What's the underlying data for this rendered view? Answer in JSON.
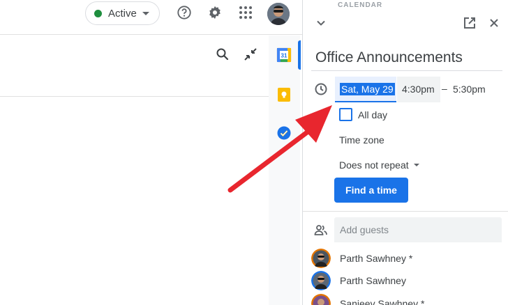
{
  "header": {
    "status_label": "Active",
    "icons": [
      "help-icon",
      "settings-icon",
      "apps-grid-icon",
      "account-avatar"
    ]
  },
  "subbar": {
    "icons": [
      "search-icon",
      "collapse-icon"
    ]
  },
  "side_panel": {
    "apps": [
      "calendar-app-icon",
      "keep-app-icon",
      "tasks-app-icon"
    ],
    "calendar_icon_number": "31"
  },
  "event_panel": {
    "section_label": "CALENDAR",
    "title": "Office Announcements",
    "date": "Sat, May 29",
    "start_time": "4:30pm",
    "separator": "–",
    "end_time": "5:30pm",
    "all_day_label": "All day",
    "all_day_checked": false,
    "time_zone_label": "Time zone",
    "repeat_label": "Does not repeat",
    "find_time_label": "Find a time",
    "guests_placeholder": "Add guests",
    "guests": [
      {
        "name": "Parth Sawhney *"
      },
      {
        "name": "Parth Sawhney"
      },
      {
        "name": "Sanjeev Sawhney *"
      }
    ]
  },
  "colors": {
    "accent": "#1a73e8",
    "status_green": "#1e8e3e",
    "annotation_arrow": "#e8262e"
  }
}
